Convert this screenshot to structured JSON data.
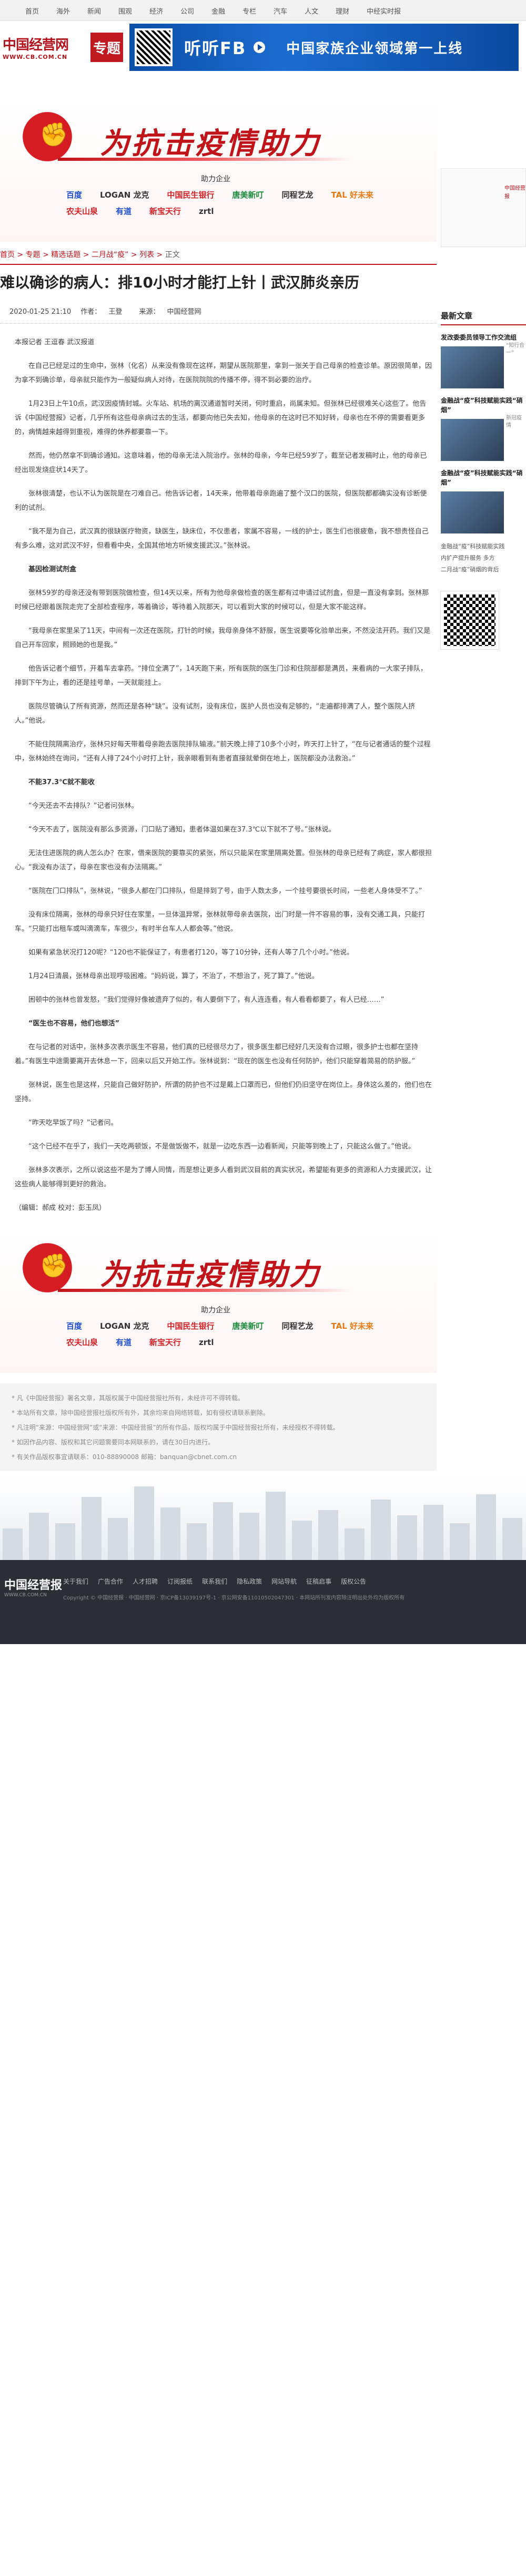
{
  "topnav": [
    "首页",
    "海外",
    "新闻",
    "围观",
    "经济",
    "公司",
    "金融",
    "专栏",
    "汽车",
    "人文",
    "理财",
    "中经实时报"
  ],
  "logo": {
    "main": "中国经营网",
    "url": "WWW.CB.COM.CN",
    "zhuanti": "专题"
  },
  "ad": {
    "listen": "听听FB",
    "slogan": "中国家族企业领域第一上线"
  },
  "fight": {
    "title": "为抗击疫情助力",
    "assist": "助力企业"
  },
  "sponsors": [
    "百度",
    "LOGAN 龙克",
    "中国民生银行",
    "唐美新叮",
    "同程艺龙",
    "TAL 好未来",
    "农夫山泉",
    "有道",
    "新宝天行",
    "zrtl"
  ],
  "breadcrumb": {
    "items": [
      "首页",
      "专题",
      "精选话题",
      "二月战“疫”",
      "列表"
    ],
    "current": "正文"
  },
  "article": {
    "title": "难以确诊的病人：排10小时才能打上针丨武汉肺炎亲历",
    "date": "2020-01-25 21:10",
    "author_label": "作者：",
    "author": "王登",
    "source_label": "来源：",
    "source": "中国经营网",
    "paragraphs": [
      {
        "t": "本报记者 王逗春 武汉报道",
        "cls": "noindent"
      },
      {
        "t": "在自己已经足过的生命中，张林（化名）从来没有像现在这样，期望从医院那里，拿到一张关于自己母亲的检查诊单。原因很简单，因为拿不到确诊单，母亲就只能作为一般疑似病人对待，在医院院院的传播不停，得不到必要的治疗。",
        "cls": ""
      },
      {
        "t": "1月23日上午10点，武汉因疫情封城。火车站、机场的离汉通道暂时关闭，何时重启，尚属未知。但张林已经很难关心这些了。他告诉《中国经营报》记者，几乎所有这些母亲病过去的生活，都要向他已失去知，他母亲的在这时已不知好转，母亲也在不停的需要看更多的，病情越来越得到重视，难得的休养都要靠一下。",
        "cls": ""
      },
      {
        "t": "然而，他仍然拿不到确诊通知。这意味着，他的母亲无法入院治疗。张林的母亲，今年已经59岁了，截至记者发稿时止，他的母亲已经出现发烧症状14天了。",
        "cls": ""
      },
      {
        "t": "张林很清楚，也认不认为医院是在刁难自己。他告诉记者，14天来，他带着母亲跑遍了整个汉口的医院，但医院都都确实没有诊断便利的试剂。",
        "cls": ""
      },
      {
        "t": "“我不是为自己，武汉真的很缺医疗物资，缺医生，缺床位，不仅患者，家属不容易，一线的护士，医生们也很疲惫，我不想责怪自己有多么难，这对武汉不好，但看看中央，全国其他地方听候支援武汉。”张林说。",
        "cls": ""
      },
      {
        "t": "基因检测试剂盒",
        "cls": "head"
      },
      {
        "t": "张林59岁的母亲还没有带到医院做检查，但14天以来，所有为他母亲做检查的医生都有过申请过试剂盒，但是一直没有拿到。张林那时候已经跟着医院走完了全部检查程序，等着确诊，等待着入院那天，可以看到大家的时候可以，但是大家不能这样。",
        "cls": ""
      },
      {
        "t": "“我母亲在家里呆了11天，中间有一次还在医院，打针的时候，我母亲身体不舒服，医生说要等化验单出来，不然没法开药。我们又是自己开车回家，照顾她的也是我。”",
        "cls": ""
      },
      {
        "t": "他告诉记者个细节，开着车去拿药。“排位全满了”，14天跑下来，所有医院的医生门诊和住院部都是满员，来看病的一大家子排队，排到下午为止，看的还是挂号单，一天就能挂上。",
        "cls": ""
      },
      {
        "t": "医院尽管确认了所有资源，然而还是各种“缺”。没有试剂，没有床位，医护人员也没有足够的，“走遍都排满了人，整个医院人挤人。”他说。",
        "cls": ""
      },
      {
        "t": "不能住院隔离治疗，张林只好每天带着母亲跑去医院排队输液。”前天晚上排了10多个小时，昨天打上针了，“在与记者通话的整个过程中，张林始终在询问，“还有人排了24个小时打上针，我亲眼看到有患者直接就晕倒在地上，医院都没办法救治。”",
        "cls": ""
      },
      {
        "t": "不能37.3℃就不能收",
        "cls": "head"
      },
      {
        "t": "“今天还去不去排队？”记者问张林。",
        "cls": ""
      },
      {
        "t": "“今天不去了，医院没有那么多资源，门口贴了通知，患者体温如果在37.3℃以下就不了号。”张林说。",
        "cls": ""
      },
      {
        "t": "无法住进医院的病人怎么办？在家，借来医院的要靠买的紧张，所以只能呆在家里隔离处置。但张林的母亲已经有了病症，家人都很担心。“我没有办法了，母亲在家也没有办法隔离。”",
        "cls": ""
      },
      {
        "t": "“医院在门口排队”，张林说，“很多人都在门口排队，但是排到了号，由于人数太多，一个挂号要很长时间，一些老人身体受不了。”",
        "cls": ""
      },
      {
        "t": "没有床位隔离，张林的母亲只好住在家里，一旦体温异常，张林就带母亲去医院，出门时是一件不容易的事，没有交通工具，只能打车。“只能打出租车或叫滴滴车，车很少，有时半台车人人都会等。”他说。",
        "cls": ""
      },
      {
        "t": "如果有紧急状况打120呢？“120也不能保证了，有患者打120，等了10分钟，还有人等了几个小时。”他说。",
        "cls": ""
      },
      {
        "t": "1月24日清晨，张林母亲出现呼吸困难。“妈妈说，算了，不治了，不想治了，死了算了。”他说。",
        "cls": ""
      },
      {
        "t": "困顿中的张林也曾发怒，“我们觉得好像被遗弃了似的，有人要倒下了，有人连连看，有人看看都要了，有人已经……”",
        "cls": ""
      },
      {
        "t": "“医生也不容易，他们也想活”",
        "cls": "head"
      },
      {
        "t": "在与记者的对话中，张林多次表示医生不容易，他们真的已经很尽力了，很多医生都已经好几天没有合过眼，很多护士也都在坚持着。”有医生中途需要离开去休息一下，回来以后又开始工作。张林说到：“现在的医生也没有任何防护，他们只能穿着简易的防护服。”",
        "cls": ""
      },
      {
        "t": "张林说，医生也是这样，只能自己做好防护，所谓的防护也不过是戴上口罩而已，但他们仍旧坚守在岗位上。身体这么差的，他们也在坚持。",
        "cls": ""
      },
      {
        "t": "“昨天吃早饭了吗？”记者问。",
        "cls": ""
      },
      {
        "t": "“这个已经不在乎了，我们一天吃两顿饭，不是做饭做不，就是一边吃东西一边看新闻，只能等到晚上了，只能这么做了。”他说。",
        "cls": ""
      },
      {
        "t": "张林多次表示，之所以说这些不是为了博人同情，而是想让更多人看到武汉目前的真实状况，希望能有更多的资源和人力支援武汉，让这些病人能够得到更好的救治。",
        "cls": ""
      },
      {
        "t": "（编辑：郝成 校对：彭玉凤）",
        "cls": "noindent"
      }
    ]
  },
  "notices": [
    "* 凡《中国经营报》署名文章，其版权属于中国经营报社所有，未经许可不得转载。",
    "* 本站所有文章，除中国经营报社版权所有外，其余均来自网络转载，如有侵权请联系删除。",
    "* 凡注明“来源：中国经营网”或“来源：中国经营报”的所有作品，版权均属于中国经营报社所有，未经授权不得转载。",
    "* 如因作品内容、版权和其它问题需要同本网联系的，请在30日内进行。",
    "* 有关作品版权事宜请联系：010-88890008 邮箱：banquan@cbnet.com.cn"
  ],
  "side": {
    "latest": "最新文章",
    "items": [
      {
        "title": "发改委委员领导工作交流组",
        "snip": "“知行合一”"
      },
      {
        "title": "金融战“疫”科技赋能实践“硝烟”",
        "snip": "新冠疫情"
      },
      {
        "title": "金融战“疫”科技赋能实践“硝烟”",
        "snip": ""
      }
    ],
    "lines": [
      "金融战“疫”科技赋能实践",
      "内扩产提升服务 多方",
      "二月战“疫”硝烟的背后"
    ],
    "qr_text": "中国经营报"
  },
  "footer": {
    "logo": "中国经营报",
    "url": "WWW.CB.COM.CN",
    "links": [
      "关于我们",
      "广告合作",
      "人才招聘",
      "订阅报纸",
      "联系我们",
      "隐私政策",
      "网站导航",
      "征稿启事",
      "版权公告"
    ],
    "copy": "Copyright © 中国经营报 · 中国经营网 · 京ICP备13039197号-1 · 京公网安备11010502047301 · 本网站所刊发内容除注明出处外均为版权所有"
  }
}
